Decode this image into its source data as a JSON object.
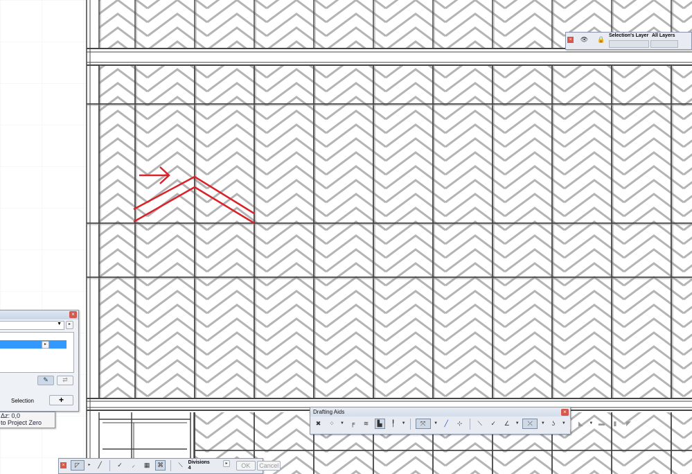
{
  "layer_palette": {
    "selection_layer_label": "Selection's Layer",
    "all_layers_label": "All Layers"
  },
  "left_panel": {
    "selection_label": "Selection",
    "add_button": "+",
    "coord_label": "Δz: 0,0",
    "project_zero_label": "to Project Zero"
  },
  "drafting_aids": {
    "title": "Drafting Aids"
  },
  "edit_toolbar": {
    "divisions_label": "Divisions",
    "divisions_value": "4",
    "ok_label": "OK",
    "cancel_label": "Cancel"
  },
  "colors": {
    "hatch": "#b4b4b4",
    "annotation": "#d8232a",
    "palette_bg": "#e8ecf2"
  }
}
